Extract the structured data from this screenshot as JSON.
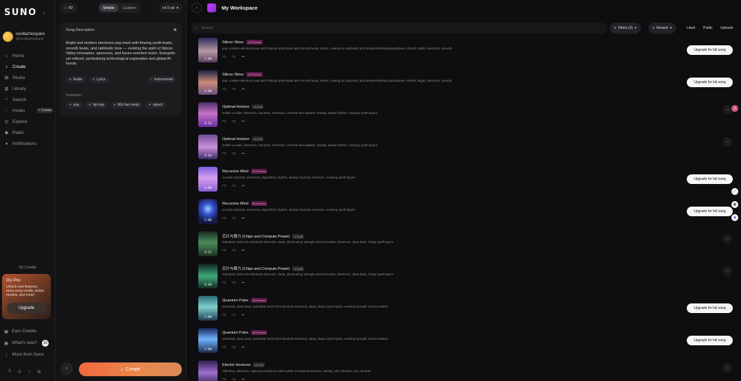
{
  "sidebar": {
    "logo": "SUNO",
    "user": {
      "name": "cecillazhouyanx",
      "handle": "@cecillazhouyanx"
    },
    "nav": [
      {
        "label": "Home",
        "icon": "⌂"
      },
      {
        "label": "Create",
        "icon": "♪"
      },
      {
        "label": "Studio",
        "icon": "▤"
      },
      {
        "label": "Library",
        "icon": "▥"
      },
      {
        "label": "Search",
        "icon": "⌕"
      },
      {
        "label": "Hooks",
        "icon": "◌"
      },
      {
        "label": "Explore",
        "icon": "◎"
      },
      {
        "label": "Radio",
        "icon": "◉"
      },
      {
        "label": "Notifications",
        "icon": "♦"
      }
    ],
    "hooks_create": "+ Create",
    "credits": "50 Credits",
    "gopro": {
      "title": "Go Pro",
      "desc": "Unlock new features, more song credits, better models, and more!",
      "button": "Upgrade"
    },
    "bottom": [
      {
        "label": "Earn Credits",
        "icon": "▣"
      },
      {
        "label": "What's new?",
        "icon": "▣",
        "badge": "20"
      },
      {
        "label": "More from Suno",
        "icon": "⋮"
      }
    ],
    "socials": [
      "X",
      "◎",
      "♪",
      "◍"
    ]
  },
  "create": {
    "credits": "50",
    "tabs": [
      "Simple",
      "Custom"
    ],
    "active_tab": "Simple",
    "version": "v4.5-all",
    "song_description_label": "Song Description",
    "song_description": "Bright and modern electronic-pop track with flowing synth leads, smooth beats, and optimistic tone — evoking the spirit of Silicon Valley innovation, openness, and future-oriented vision. Energetic yet refined, symbolizing technological exploration and global AI trends.",
    "options": [
      "Audio",
      "Lyrics"
    ],
    "instrumental": "Instrumental",
    "inspiration_label": "Inspiration",
    "inspiration_tags": [
      "pop",
      "hip hop",
      "80s hair metal",
      "episch"
    ],
    "create_button": "Create"
  },
  "main": {
    "title": "My Workspace",
    "search_placeholder": "Search",
    "filters": "Filters (3)",
    "sort": "Newest",
    "segments": [
      "Liked",
      "Public",
      "Uploads"
    ],
    "upgrade_label": "Upgrade for full song",
    "songs": [
      {
        "title": "Silicon Skies",
        "badge": "v5 Preview",
        "badge_kind": "pre",
        "duration": "1:00",
        "art": "art-a",
        "upgrade": true,
        "desc": "pop, modern electronic-pop with flowing synth leads and smooth beats, beats, creating an optimistic and forward-thinking atmosphere, refined, bright, electronic, smooth"
      },
      {
        "title": "Silicon Skies",
        "badge": "v5 Preview",
        "badge_kind": "pre",
        "duration": "1:00",
        "art": "art-b",
        "upgrade": true,
        "desc": "pop, modern electronic-pop with flowing synth leads and smooth beats, beats, creating an optimistic and forward-thinking atmosphere, refined, bright, electronic, smooth"
      },
      {
        "title": "Optimal Horizon",
        "badge": "v4.5-all",
        "badge_kind": "v45",
        "duration": "3:12",
        "art": "art-c",
        "upgrade": false,
        "desc": "subtle vocoder, electronic, futuristic, electronic, cerebral atmosphere, steady, steady rhythm, evolving synth layers"
      },
      {
        "title": "Optimal Horizon",
        "badge": "v4.5-all",
        "badge_kind": "v45",
        "duration": "3:44",
        "art": "art-d",
        "upgrade": false,
        "desc": "subtle vocoder, electronic, futuristic, electronic, cerebral atmosphere, steady, steady rhythm, evolving synth layers"
      },
      {
        "title": "Recursive Mind",
        "badge": "v5 Preview",
        "badge_kind": "pre",
        "duration": "1:00",
        "art": "art-e",
        "upgrade": true,
        "desc": "vocoder textures, electronic, algorithmic rhythm, steady, futuristic electronic, evolving synth layers"
      },
      {
        "title": "Recursive Mind",
        "badge": "v5 Preview",
        "badge_kind": "pre",
        "duration": "1:00",
        "art": "art-f",
        "upgrade": true,
        "desc": "vocoder textures, electronic, algorithmic rhythm, steady, futuristic electronic, evolving synth layers"
      },
      {
        "title": "芯片与算力 (Chips and Compute Power)",
        "badge": "v4.5-all",
        "badge_kind": "v45",
        "duration": "3:27",
        "art": "art-g",
        "upgrade": false,
        "desc": "industrial, bold tech-industrial electronic, deep, showcasing strength and innovation, electronic, deep bass, sharp synth layers"
      },
      {
        "title": "芯片与算力 (Chips and Compute Power)",
        "badge": "v4.5-all",
        "badge_kind": "v45",
        "duration": "4:48",
        "art": "art-h",
        "upgrade": false,
        "desc": "industrial, bold tech-industrial electronic, deep, showcasing strength and innovation, electronic, deep bass, sharp synth layers"
      },
      {
        "title": "Quantum Pulse",
        "badge": "v5 Preview",
        "badge_kind": "pre",
        "duration": "1:00",
        "art": "art-i",
        "upgrade": true,
        "desc": "electronic, deep bass, industrial, bold tech-industrial electronic, deep, sharp synth layers, evoking strength and innovation"
      },
      {
        "title": "Quantum Pulse",
        "badge": "v5 Preview",
        "badge_kind": "pre",
        "duration": "1:00",
        "art": "art-j",
        "upgrade": true,
        "desc": "electronic, deep bass, industrial, bold tech-industrial electronic, deep, sharp synth layers, evoking strength and innovation"
      },
      {
        "title": "Electric Horizons",
        "badge": "v4.5-all",
        "badge_kind": "v45",
        "duration": "",
        "art": "art-k",
        "upgrade": false,
        "desc": "reflective, electronic, spacious ambience with subtle mechanical textures, steady, soft, futuristic, low, minimal"
      }
    ]
  }
}
